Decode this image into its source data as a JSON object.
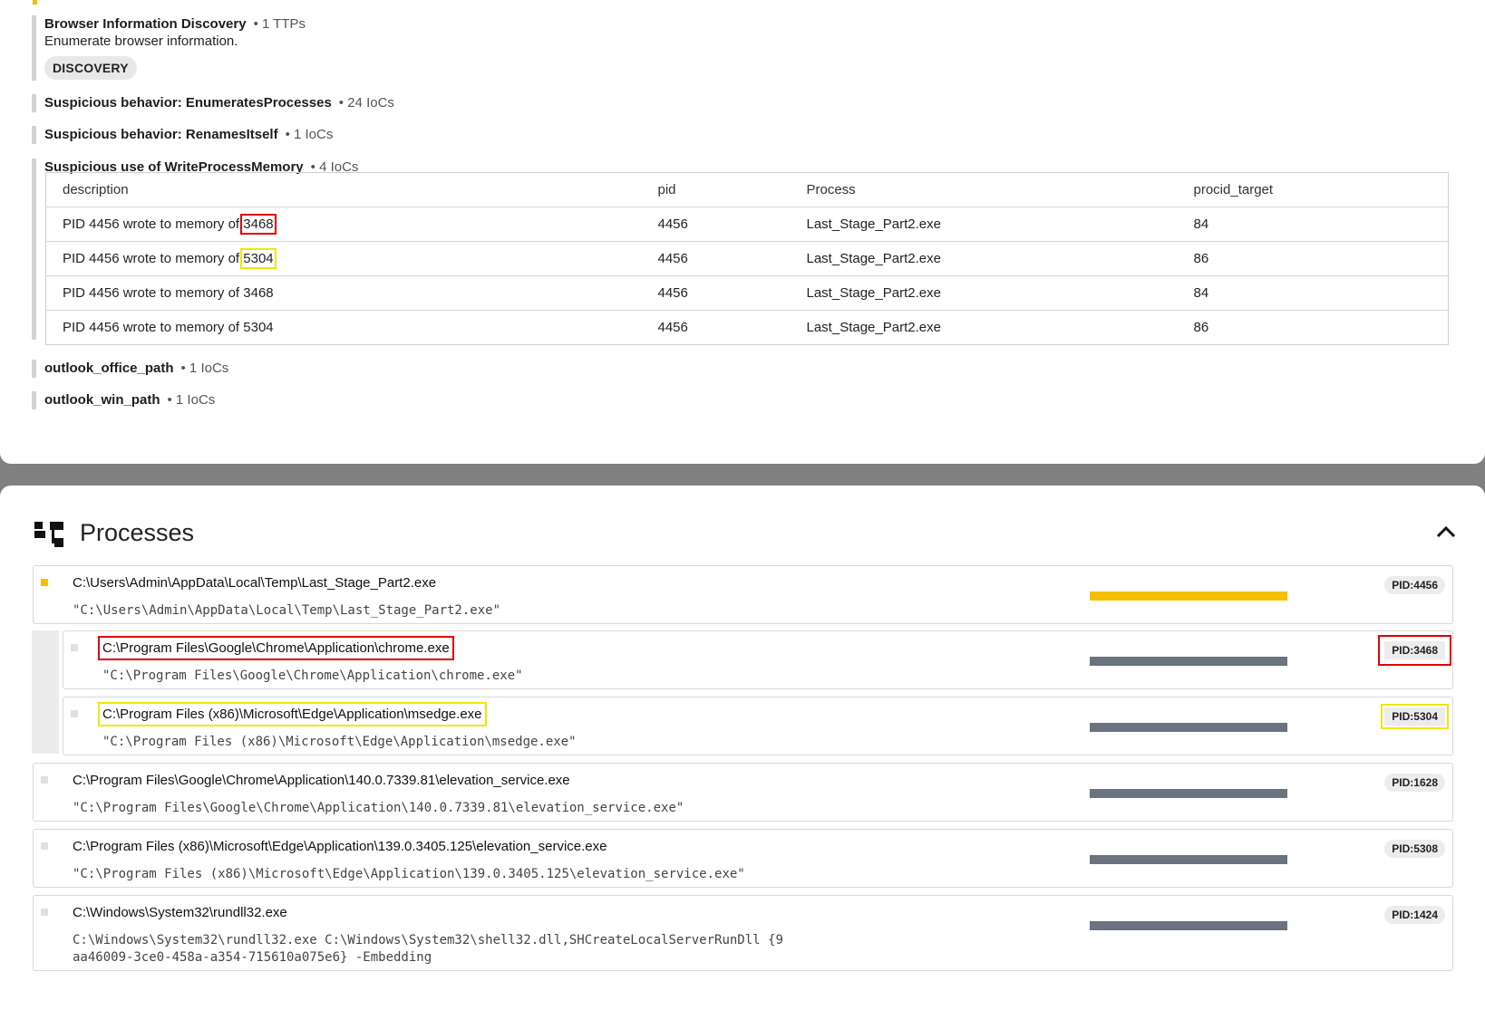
{
  "behaviors": {
    "browser_discovery": {
      "name": "Browser Information Discovery",
      "count": "• 1 TTPs",
      "desc": "Enumerate browser information.",
      "tag": "DISCOVERY"
    },
    "enum_processes": {
      "name": "Suspicious behavior: EnumeratesProcesses",
      "count": "• 24 IoCs"
    },
    "renames_itself": {
      "name": "Suspicious behavior: RenamesItself",
      "count": "• 1 IoCs"
    },
    "write_process_memory": {
      "name": "Suspicious use of WriteProcessMemory",
      "count": "• 4 IoCs"
    },
    "outlook_office_path": {
      "name": "outlook_office_path",
      "count": "• 1 IoCs"
    },
    "outlook_win_path": {
      "name": "outlook_win_path",
      "count": "• 1 IoCs"
    }
  },
  "ioc_table": {
    "headers": [
      "description",
      "pid",
      "Process",
      "procid_target"
    ],
    "rows": [
      {
        "desc_prefix": "PID 4456 wrote to memory of",
        "target": "3468",
        "pid": "4456",
        "process": "Last_Stage_Part2.exe",
        "procid_target": "84"
      },
      {
        "desc_prefix": "PID 4456 wrote to memory of",
        "target": "5304",
        "pid": "4456",
        "process": "Last_Stage_Part2.exe",
        "procid_target": "86"
      },
      {
        "desc_prefix": "PID 4456 wrote to memory of",
        "target": "3468",
        "pid": "4456",
        "process": "Last_Stage_Part2.exe",
        "procid_target": "84"
      },
      {
        "desc_prefix": "PID 4456 wrote to memory of",
        "target": "5304",
        "pid": "4456",
        "process": "Last_Stage_Part2.exe",
        "procid_target": "86"
      }
    ]
  },
  "processes": {
    "title": "Processes",
    "list": [
      {
        "path": "C:\\Users\\Admin\\AppData\\Local\\Temp\\Last_Stage_Part2.exe",
        "cmd": "\"C:\\Users\\Admin\\AppData\\Local\\Temp\\Last_Stage_Part2.exe\"",
        "pid": "PID:4456"
      },
      {
        "path": "C:\\Program Files\\Google\\Chrome\\Application\\chrome.exe",
        "cmd": "\"C:\\Program Files\\Google\\Chrome\\Application\\chrome.exe\"",
        "pid": "PID:3468"
      },
      {
        "path": "C:\\Program Files (x86)\\Microsoft\\Edge\\Application\\msedge.exe",
        "cmd": "\"C:\\Program Files (x86)\\Microsoft\\Edge\\Application\\msedge.exe\"",
        "pid": "PID:5304"
      },
      {
        "path": "C:\\Program Files\\Google\\Chrome\\Application\\140.0.7339.81\\elevation_service.exe",
        "cmd": "\"C:\\Program Files\\Google\\Chrome\\Application\\140.0.7339.81\\elevation_service.exe\"",
        "pid": "PID:1628"
      },
      {
        "path": "C:\\Program Files (x86)\\Microsoft\\Edge\\Application\\139.0.3405.125\\elevation_service.exe",
        "cmd": "\"C:\\Program Files (x86)\\Microsoft\\Edge\\Application\\139.0.3405.125\\elevation_service.exe\"",
        "pid": "PID:5308"
      },
      {
        "path": "C:\\Windows\\System32\\rundll32.exe",
        "cmd": "C:\\Windows\\System32\\rundll32.exe C:\\Windows\\System32\\shell32.dll,SHCreateLocalServerRunDll {9\naa46009-3ce0-458a-a354-715610a075e6} -Embedding",
        "pid": "PID:1424"
      }
    ]
  },
  "colors": {
    "accent": "#f5c000",
    "bar": "#6b7280",
    "highlight_red": "#e00000",
    "highlight_yellow": "#f0e800"
  }
}
